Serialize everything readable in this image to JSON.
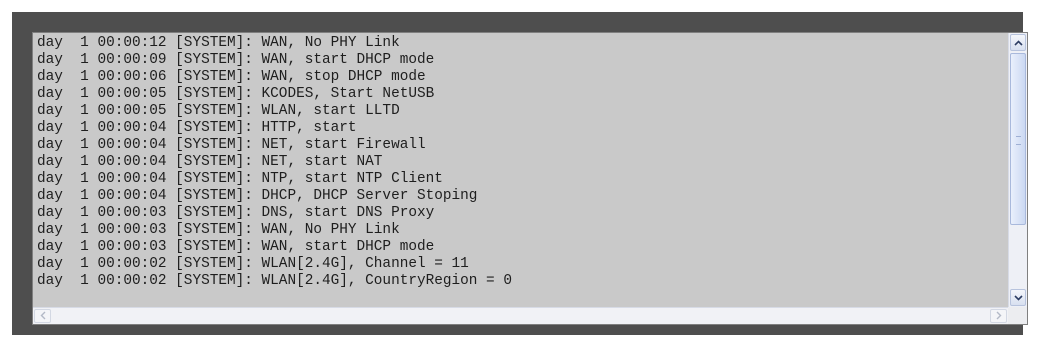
{
  "log": {
    "lines": [
      "day  1 00:00:12 [SYSTEM]: WAN, No PHY Link",
      "day  1 00:00:09 [SYSTEM]: WAN, start DHCP mode",
      "day  1 00:00:06 [SYSTEM]: WAN, stop DHCP mode",
      "day  1 00:00:05 [SYSTEM]: KCODES, Start NetUSB",
      "day  1 00:00:05 [SYSTEM]: WLAN, start LLTD",
      "day  1 00:00:04 [SYSTEM]: HTTP, start",
      "day  1 00:00:04 [SYSTEM]: NET, start Firewall",
      "day  1 00:00:04 [SYSTEM]: NET, start NAT",
      "day  1 00:00:04 [SYSTEM]: NTP, start NTP Client",
      "day  1 00:00:04 [SYSTEM]: DHCP, DHCP Server Stoping",
      "day  1 00:00:03 [SYSTEM]: DNS, start DNS Proxy",
      "day  1 00:00:03 [SYSTEM]: WAN, No PHY Link",
      "day  1 00:00:03 [SYSTEM]: WAN, start DHCP mode",
      "day  1 00:00:02 [SYSTEM]: WLAN[2.4G], Channel = 11",
      "day  1 00:00:02 [SYSTEM]: WLAN[2.4G], CountryRegion = 0"
    ]
  },
  "scrollbar": {
    "up_icon": "chevron-up-icon",
    "down_icon": "chevron-down-icon",
    "left_icon": "chevron-left-icon",
    "right_icon": "chevron-right-icon"
  },
  "colors": {
    "frame": "#4e4e4e",
    "log_background": "#c9c9c9",
    "log_text": "#1e1e1e",
    "scroll_thumb": "#cbd8f2"
  }
}
